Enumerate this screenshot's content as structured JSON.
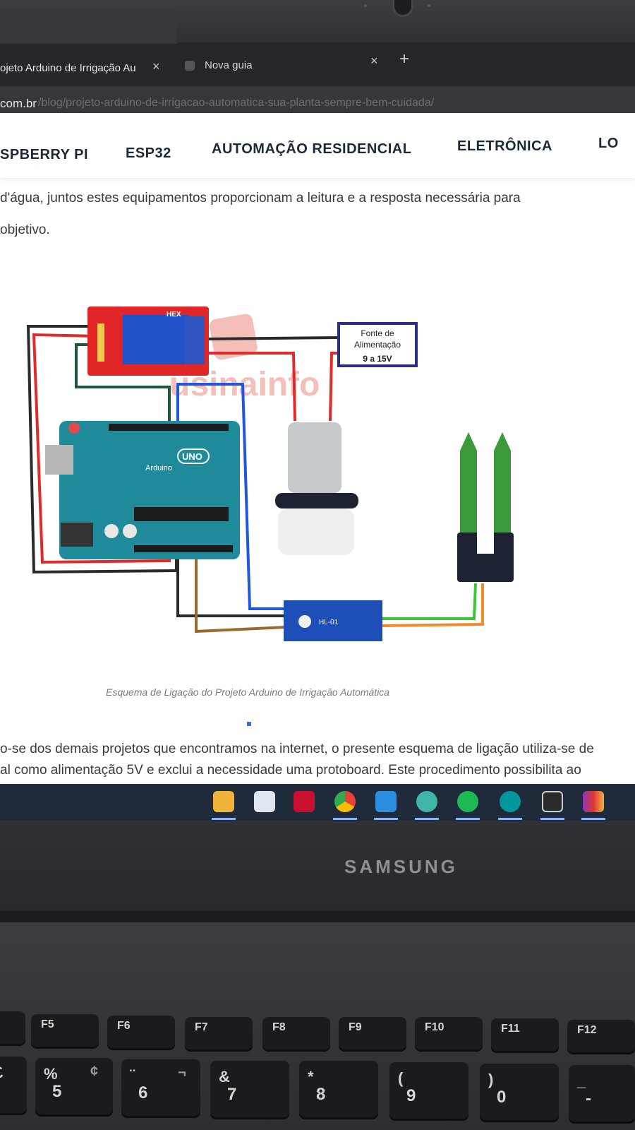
{
  "browser": {
    "active_tab_title": "ojeto Arduino de Irrigação Au",
    "second_tab_title": "Nova guia",
    "close_glyph": "×",
    "new_tab_glyph": "+",
    "url_host": "com.br",
    "url_path": "/blog/projeto-arduino-de-irrigacao-automatica-sua-planta-sempre-bem-cuidada/"
  },
  "site_nav": {
    "items": [
      "SPBERRY PI",
      "ESP32",
      "AUTOMAÇÃO RESIDENCIAL",
      "ELETRÔNICA",
      "LO"
    ]
  },
  "article": {
    "para1_line1": "d'água, juntos estes equipamentos proporcionam a leitura e a resposta necessária para",
    "para1_line2": "objetivo.",
    "figure_caption": "Esquema de Ligação do Projeto Arduino de Irrigação Automática",
    "para2_line1": "o-se dos demais projetos que encontramos na internet, o presente esquema de ligação utiliza-se de",
    "para2_line2": "al como alimentação 5V e exclui a necessidade uma protoboard. Este procedimento possibilita ao"
  },
  "diagram": {
    "power_supply_label_1": "Fonte de",
    "power_supply_label_2": "Alimentação",
    "power_supply_label_3": "9 a 15V",
    "watermark": "usinainfo",
    "relay_label": "HEX",
    "arduino_brand": "Arduino",
    "arduino_model": "UNO",
    "sensor_module_label": "HL-01"
  },
  "taskbar": {
    "apps": [
      "file-explorer",
      "microsoft-store",
      "mcafee",
      "chrome",
      "vscode",
      "edge",
      "spotify",
      "arduino-ide",
      "terminal",
      "winrar"
    ]
  },
  "laptop": {
    "brand": "SAMSUNG",
    "fn_keys": [
      "F5",
      "F6",
      "F7",
      "F8",
      "F9",
      "F10",
      "F11",
      "F12"
    ],
    "number_keys": [
      {
        "top": "%",
        "alt": "¢",
        "main": "5"
      },
      {
        "top": "¨",
        "alt": "¬",
        "main": "6"
      },
      {
        "top": "&",
        "alt": "",
        "main": "7"
      },
      {
        "top": "*",
        "alt": "",
        "main": "8"
      },
      {
        "top": "(",
        "alt": "",
        "main": "9"
      },
      {
        "top": ")",
        "alt": "",
        "main": "0"
      },
      {
        "top": "_",
        "alt": "",
        "main": "-"
      }
    ],
    "pound_key": "£"
  }
}
